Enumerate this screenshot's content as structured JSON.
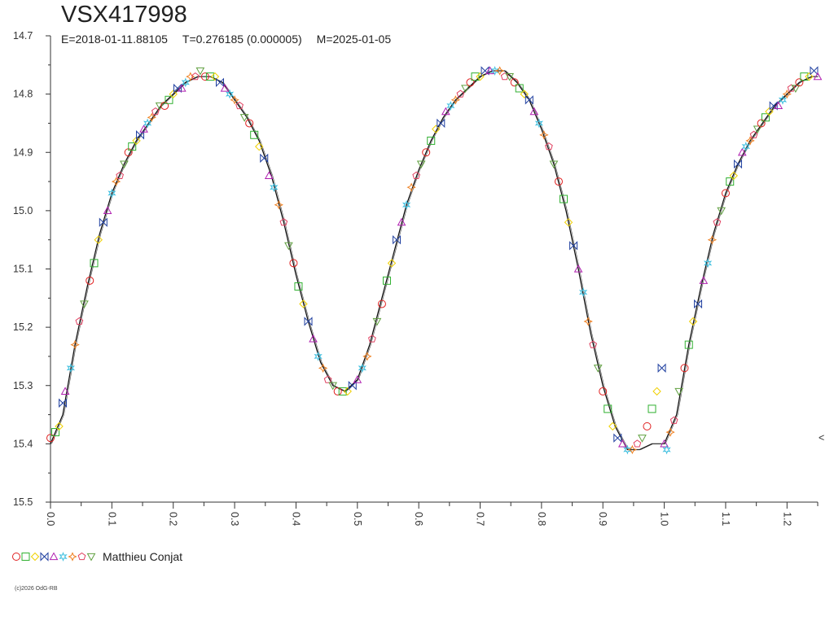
{
  "header": {
    "title": "VSX417998",
    "epoch": "E=2018-01-11.88105",
    "period": "T=0.276185 (0.000005)",
    "max_date": "M=2025-01-05"
  },
  "legend": {
    "observer": "Matthieu Conjat",
    "symbols": [
      "circle",
      "square",
      "diamond",
      "bowtie",
      "triangle",
      "star",
      "star4",
      "pentagon",
      "triangle-down"
    ],
    "symbol_colors": [
      "#e02020",
      "#30b030",
      "#f0d000",
      "#2040a0",
      "#b020b0",
      "#40c0e0",
      "#f08020",
      "#e04060",
      "#60a040"
    ]
  },
  "footer": {
    "copyright": "(c)2026 OdG-RB"
  },
  "offscale_marker": "<",
  "chart_data": {
    "type": "scatter",
    "title": "VSX417998",
    "xlabel": "",
    "ylabel": "",
    "xlim": [
      0.0,
      1.25
    ],
    "ylim": [
      15.5,
      14.7
    ],
    "y_inverted": true,
    "grid": false,
    "x_ticks": [
      "0.0",
      "0.1",
      "0.2",
      "0.3",
      "0.4",
      "0.5",
      "0.6",
      "0.7",
      "0.8",
      "0.9",
      "1.0",
      "1.1",
      "1.2"
    ],
    "y_ticks": [
      "14.7",
      "14.8",
      "14.9",
      "15.0",
      "15.1",
      "15.2",
      "15.3",
      "15.4",
      "15.5"
    ],
    "series": [
      {
        "name": "Matthieu Conjat",
        "points": [
          [
            0.0,
            15.39
          ],
          [
            0.008,
            15.38
          ],
          [
            0.014,
            15.37
          ],
          [
            0.02,
            15.33
          ],
          [
            0.024,
            15.31
          ],
          [
            0.033,
            15.27
          ],
          [
            0.04,
            15.23
          ],
          [
            0.047,
            15.19
          ],
          [
            0.055,
            15.16
          ],
          [
            0.064,
            15.12
          ],
          [
            0.071,
            15.09
          ],
          [
            0.078,
            15.05
          ],
          [
            0.086,
            15.02
          ],
          [
            0.093,
            15.0
          ],
          [
            0.1,
            14.97
          ],
          [
            0.107,
            14.95
          ],
          [
            0.113,
            14.94
          ],
          [
            0.12,
            14.92
          ],
          [
            0.127,
            14.9
          ],
          [
            0.133,
            14.89
          ],
          [
            0.14,
            14.88
          ],
          [
            0.146,
            14.87
          ],
          [
            0.152,
            14.86
          ],
          [
            0.158,
            14.85
          ],
          [
            0.165,
            14.84
          ],
          [
            0.171,
            14.83
          ],
          [
            0.178,
            14.82
          ],
          [
            0.186,
            14.82
          ],
          [
            0.193,
            14.81
          ],
          [
            0.2,
            14.8
          ],
          [
            0.207,
            14.79
          ],
          [
            0.214,
            14.79
          ],
          [
            0.22,
            14.78
          ],
          [
            0.228,
            14.77
          ],
          [
            0.236,
            14.77
          ],
          [
            0.244,
            14.76
          ],
          [
            0.252,
            14.77
          ],
          [
            0.26,
            14.77
          ],
          [
            0.268,
            14.77
          ],
          [
            0.276,
            14.78
          ],
          [
            0.284,
            14.79
          ],
          [
            0.292,
            14.8
          ],
          [
            0.3,
            14.81
          ],
          [
            0.308,
            14.82
          ],
          [
            0.316,
            14.84
          ],
          [
            0.324,
            14.85
          ],
          [
            0.332,
            14.87
          ],
          [
            0.34,
            14.89
          ],
          [
            0.348,
            14.91
          ],
          [
            0.356,
            14.94
          ],
          [
            0.364,
            14.96
          ],
          [
            0.372,
            14.99
          ],
          [
            0.38,
            15.02
          ],
          [
            0.388,
            15.06
          ],
          [
            0.396,
            15.09
          ],
          [
            0.404,
            15.13
          ],
          [
            0.412,
            15.16
          ],
          [
            0.42,
            15.19
          ],
          [
            0.428,
            15.22
          ],
          [
            0.436,
            15.25
          ],
          [
            0.444,
            15.27
          ],
          [
            0.452,
            15.29
          ],
          [
            0.46,
            15.3
          ],
          [
            0.468,
            15.31
          ],
          [
            0.476,
            15.31
          ],
          [
            0.484,
            15.31
          ],
          [
            0.492,
            15.3
          ],
          [
            0.5,
            15.29
          ],
          [
            0.508,
            15.27
          ],
          [
            0.516,
            15.25
          ],
          [
            0.524,
            15.22
          ],
          [
            0.532,
            15.19
          ],
          [
            0.54,
            15.16
          ],
          [
            0.548,
            15.12
          ],
          [
            0.556,
            15.09
          ],
          [
            0.564,
            15.05
          ],
          [
            0.572,
            15.02
          ],
          [
            0.58,
            14.99
          ],
          [
            0.588,
            14.96
          ],
          [
            0.596,
            14.94
          ],
          [
            0.604,
            14.92
          ],
          [
            0.612,
            14.9
          ],
          [
            0.62,
            14.88
          ],
          [
            0.628,
            14.86
          ],
          [
            0.636,
            14.85
          ],
          [
            0.644,
            14.83
          ],
          [
            0.652,
            14.82
          ],
          [
            0.66,
            14.81
          ],
          [
            0.668,
            14.8
          ],
          [
            0.676,
            14.79
          ],
          [
            0.684,
            14.78
          ],
          [
            0.692,
            14.77
          ],
          [
            0.7,
            14.77
          ],
          [
            0.708,
            14.76
          ],
          [
            0.716,
            14.76
          ],
          [
            0.724,
            14.76
          ],
          [
            0.732,
            14.76
          ],
          [
            0.74,
            14.77
          ],
          [
            0.748,
            14.77
          ],
          [
            0.756,
            14.78
          ],
          [
            0.764,
            14.79
          ],
          [
            0.772,
            14.8
          ],
          [
            0.78,
            14.81
          ],
          [
            0.788,
            14.83
          ],
          [
            0.796,
            14.85
          ],
          [
            0.804,
            14.87
          ],
          [
            0.812,
            14.89
          ],
          [
            0.82,
            14.92
          ],
          [
            0.828,
            14.95
          ],
          [
            0.836,
            14.98
          ],
          [
            0.844,
            15.02
          ],
          [
            0.852,
            15.06
          ],
          [
            0.86,
            15.1
          ],
          [
            0.868,
            15.14
          ],
          [
            0.876,
            15.19
          ],
          [
            0.884,
            15.23
          ],
          [
            0.892,
            15.27
          ],
          [
            0.9,
            15.31
          ],
          [
            0.908,
            15.34
          ],
          [
            0.916,
            15.37
          ],
          [
            0.924,
            15.39
          ],
          [
            0.932,
            15.4
          ],
          [
            0.94,
            15.41
          ],
          [
            0.948,
            15.41
          ],
          [
            0.956,
            15.4
          ],
          [
            0.964,
            15.39
          ],
          [
            0.972,
            15.37
          ],
          [
            0.98,
            15.34
          ],
          [
            0.988,
            15.31
          ],
          [
            0.996,
            15.27
          ],
          [
            1.0,
            15.4
          ],
          [
            1.004,
            15.41
          ],
          [
            1.01,
            15.38
          ],
          [
            1.016,
            15.36
          ],
          [
            1.024,
            15.31
          ],
          [
            1.033,
            15.27
          ],
          [
            1.04,
            15.23
          ],
          [
            1.047,
            15.19
          ],
          [
            1.055,
            15.16
          ],
          [
            1.064,
            15.12
          ],
          [
            1.071,
            15.09
          ],
          [
            1.078,
            15.05
          ],
          [
            1.086,
            15.02
          ],
          [
            1.093,
            15.0
          ],
          [
            1.1,
            14.97
          ],
          [
            1.107,
            14.95
          ],
          [
            1.113,
            14.94
          ],
          [
            1.12,
            14.92
          ],
          [
            1.127,
            14.9
          ],
          [
            1.133,
            14.89
          ],
          [
            1.14,
            14.88
          ],
          [
            1.146,
            14.87
          ],
          [
            1.152,
            14.86
          ],
          [
            1.158,
            14.85
          ],
          [
            1.165,
            14.84
          ],
          [
            1.171,
            14.83
          ],
          [
            1.178,
            14.82
          ],
          [
            1.186,
            14.82
          ],
          [
            1.193,
            14.81
          ],
          [
            1.2,
            14.8
          ],
          [
            1.207,
            14.79
          ],
          [
            1.214,
            14.79
          ],
          [
            1.22,
            14.78
          ],
          [
            1.228,
            14.77
          ],
          [
            1.236,
            14.77
          ],
          [
            1.244,
            14.76
          ],
          [
            1.25,
            14.77
          ]
        ]
      }
    ],
    "fit_curve": {
      "name": "",
      "points": [
        [
          0.0,
          15.4
        ],
        [
          0.02,
          15.35
        ],
        [
          0.04,
          15.23
        ],
        [
          0.06,
          15.13
        ],
        [
          0.08,
          15.04
        ],
        [
          0.1,
          14.97
        ],
        [
          0.12,
          14.92
        ],
        [
          0.14,
          14.88
        ],
        [
          0.16,
          14.85
        ],
        [
          0.18,
          14.82
        ],
        [
          0.2,
          14.8
        ],
        [
          0.22,
          14.78
        ],
        [
          0.24,
          14.77
        ],
        [
          0.26,
          14.77
        ],
        [
          0.28,
          14.78
        ],
        [
          0.3,
          14.81
        ],
        [
          0.32,
          14.84
        ],
        [
          0.34,
          14.88
        ],
        [
          0.36,
          14.94
        ],
        [
          0.38,
          15.02
        ],
        [
          0.4,
          15.11
        ],
        [
          0.42,
          15.19
        ],
        [
          0.44,
          15.26
        ],
        [
          0.46,
          15.3
        ],
        [
          0.48,
          15.31
        ],
        [
          0.5,
          15.29
        ],
        [
          0.52,
          15.23
        ],
        [
          0.54,
          15.15
        ],
        [
          0.56,
          15.07
        ],
        [
          0.58,
          14.99
        ],
        [
          0.6,
          14.93
        ],
        [
          0.62,
          14.88
        ],
        [
          0.64,
          14.84
        ],
        [
          0.66,
          14.81
        ],
        [
          0.68,
          14.79
        ],
        [
          0.7,
          14.77
        ],
        [
          0.72,
          14.76
        ],
        [
          0.74,
          14.76
        ],
        [
          0.76,
          14.78
        ],
        [
          0.78,
          14.81
        ],
        [
          0.8,
          14.86
        ],
        [
          0.82,
          14.92
        ],
        [
          0.84,
          15.0
        ],
        [
          0.86,
          15.1
        ],
        [
          0.88,
          15.21
        ],
        [
          0.9,
          15.3
        ],
        [
          0.92,
          15.37
        ],
        [
          0.94,
          15.41
        ],
        [
          0.96,
          15.41
        ],
        [
          0.98,
          15.4
        ],
        [
          1.0,
          15.4
        ],
        [
          1.02,
          15.35
        ],
        [
          1.04,
          15.23
        ],
        [
          1.06,
          15.13
        ],
        [
          1.08,
          15.04
        ],
        [
          1.1,
          14.97
        ],
        [
          1.12,
          14.92
        ],
        [
          1.14,
          14.88
        ],
        [
          1.16,
          14.85
        ],
        [
          1.18,
          14.82
        ],
        [
          1.2,
          14.8
        ],
        [
          1.22,
          14.78
        ],
        [
          1.24,
          14.77
        ],
        [
          1.25,
          14.77
        ]
      ]
    }
  }
}
